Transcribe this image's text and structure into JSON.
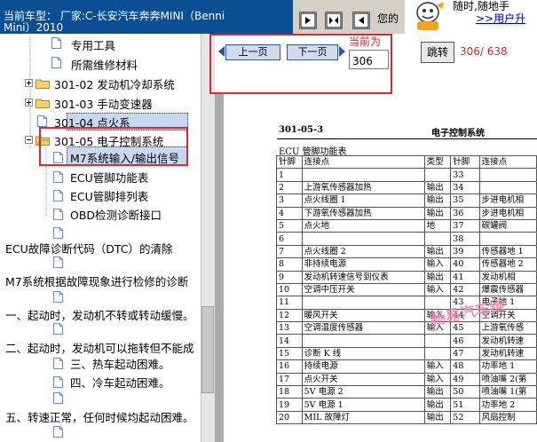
{
  "header": {
    "car_line1": "当前车型：  厂家:C-长安汽车奔奔MINI（Benni",
    "car_line2": "Mini）2010",
    "nav_label": "您的"
  },
  "ad": {
    "line1": "随时,随地手",
    "line2": ">>用户升"
  },
  "tree": {
    "items": [
      "专用工具",
      "所需维修材料",
      "301-02 发动机冷却系统",
      "301-03 手动变速器",
      "301-04 点火系",
      "301-05 电子控制系统",
      "M7系统输入/输出信号",
      "ECU管脚功能表",
      "ECU管脚排列表",
      "OBD检测诊断接口",
      "ECU故障诊断代码（DTC）的清除",
      "M7系统根据故障现象进行检修的诊断",
      "一、起动时，发动机不转或转动缓慢。",
      "二、起动时，发动机可以拖转但不能成",
      "三、热车起动困难。",
      "四、冷车起动困难。",
      "五、转速正常，任何时候均起动困难。"
    ]
  },
  "toolbar": {
    "prev": "上一页",
    "next": "下一页",
    "current_label": "当前为",
    "page_value": "306",
    "jump": "跳转",
    "page_count": "306/ 638"
  },
  "doc": {
    "code": "301-05-3",
    "section": "电子控制系统",
    "caption": "ECU 管脚功能表",
    "watermark": "畅易汽车维",
    "headers": [
      "针脚",
      "连接点",
      "类型",
      "针脚",
      "连接点"
    ],
    "rows": [
      [
        "1",
        "",
        "",
        "33",
        ""
      ],
      [
        "2",
        "上游氧传感器加热",
        "输出",
        "34",
        ""
      ],
      [
        "3",
        "点火线圈 1",
        "输出",
        "35",
        "步进电机相"
      ],
      [
        "4",
        "下游氧传感器加热",
        "输出",
        "36",
        "步进电机相"
      ],
      [
        "5",
        "点火地",
        "地",
        "37",
        "碳罐阀"
      ],
      [
        "6",
        "",
        "",
        "38",
        ""
      ],
      [
        "7",
        "点火线圈 2",
        "输出",
        "39",
        "传感器地 1"
      ],
      [
        "8",
        "非持续电源",
        "输入",
        "40",
        "传感器地 2"
      ],
      [
        "9",
        "发动机转速信号到仪表",
        "输出",
        "41",
        "发动机相"
      ],
      [
        "10",
        "空调中压开关",
        "输入",
        "42",
        "爆震传感器"
      ],
      [
        "11",
        "",
        "",
        "43",
        "电子地 1"
      ],
      [
        "12",
        "暖风开关",
        "输入",
        "44",
        "空调开关"
      ],
      [
        "13",
        "空调温度传感器",
        "输入",
        "45",
        "上游氧传感"
      ],
      [
        "14",
        "",
        "",
        "46",
        "发动机转速"
      ],
      [
        "15",
        "诊断 K 线",
        "",
        "47",
        "发动机转速"
      ],
      [
        "16",
        "持续电源",
        "输入",
        "48",
        "功率地 1"
      ],
      [
        "17",
        "点火开关",
        "输入",
        "49",
        "喷油嘴 2(第"
      ],
      [
        "18",
        "5V 电源 2",
        "输出",
        "50",
        "喷油嘴 1(第"
      ],
      [
        "19",
        "5V 电源 1",
        "输出",
        "51",
        "功率地 2"
      ],
      [
        "20",
        "MIL 故障灯",
        "输出",
        "52",
        "风扇控制"
      ]
    ]
  },
  "colors": {
    "accent_red": "#e0262f",
    "title_bar": "#0a4f93",
    "selection": "#c8d8ef"
  }
}
